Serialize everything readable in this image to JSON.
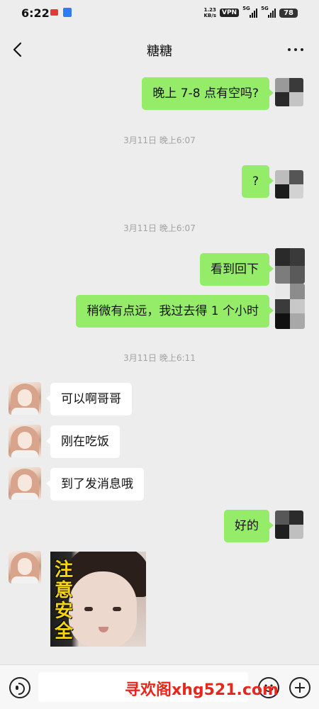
{
  "status_bar": {
    "time": "6:22",
    "net_speed_value": "1.23",
    "net_speed_unit": "KB/s",
    "vpn": "VPN",
    "sim1_network": "5G",
    "sim2_network": "5G",
    "battery": "78"
  },
  "header": {
    "title": "糖糖"
  },
  "messages": [
    {
      "from": "self",
      "type": "text",
      "text": "晚上 7-8 点有空吗?"
    },
    {
      "type": "timestamp",
      "text": "3月11日 晚上6:07"
    },
    {
      "from": "self",
      "type": "text",
      "text": "?"
    },
    {
      "type": "timestamp",
      "text": "3月11日 晚上6:07"
    },
    {
      "from": "self",
      "type": "text",
      "text": "看到回下"
    },
    {
      "from": "self",
      "type": "text",
      "text": "稍微有点远，我过去得 1 个小时"
    },
    {
      "type": "timestamp",
      "text": "3月11日 晚上6:11"
    },
    {
      "from": "contact",
      "type": "text",
      "text": "可以啊哥哥"
    },
    {
      "from": "contact",
      "type": "text",
      "text": "刚在吃饭"
    },
    {
      "from": "contact",
      "type": "text",
      "text": "到了发消息哦"
    },
    {
      "from": "self",
      "type": "text",
      "text": "好的"
    },
    {
      "from": "contact",
      "type": "sticker",
      "text": "注意安全"
    }
  ],
  "input_bar": {
    "input_value": ""
  },
  "watermark": "寻欢阁xhg521.com",
  "colors": {
    "outgoing_bubble": "#95ec69",
    "incoming_bubble": "#ffffff",
    "background": "#ededed",
    "watermark": "#e8261c"
  }
}
